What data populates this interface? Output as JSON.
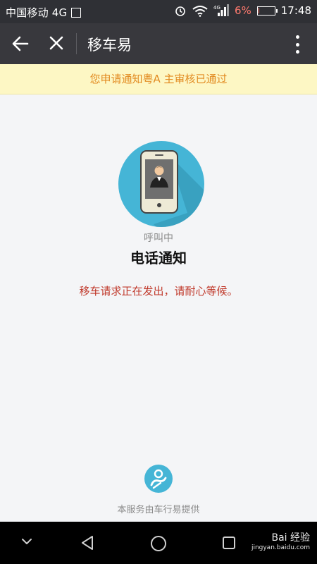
{
  "status_bar": {
    "carrier": "中国移动 4G",
    "network": "4G",
    "battery_percent": "6%",
    "battery_level": 0.06,
    "time": "17:48"
  },
  "nav": {
    "title": "移车易"
  },
  "notice": {
    "text": "您申请通知粤A          主审核已通过"
  },
  "call": {
    "status": "呼叫中",
    "title": "电话通知",
    "message": "移车请求正在发出，请耐心等候。"
  },
  "footer": {
    "provider": "本服务由车行易提供"
  },
  "watermark": {
    "brand": "Bai 经验",
    "url": "jingyan.baidu.com"
  },
  "colors": {
    "nav_bg": "#38383d",
    "notice_bg": "#fdf7c4",
    "notice_text": "#e28a1f",
    "accent": "#45b5d6",
    "warning_text": "#c0392b"
  }
}
